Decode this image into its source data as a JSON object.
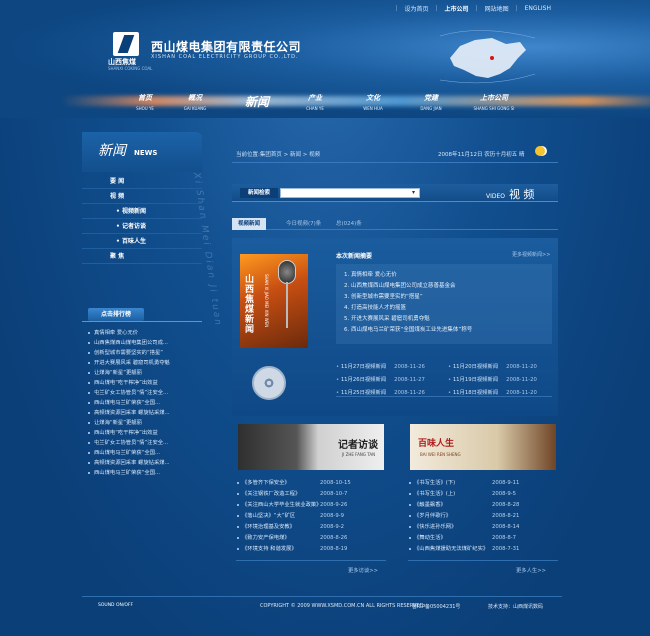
{
  "topnav": {
    "items": [
      {
        "label": "设为首页"
      },
      {
        "label": "上市公司"
      },
      {
        "label": "网站地图"
      },
      {
        "label": "ENGLISH"
      }
    ]
  },
  "logo": {
    "sub_cn": "山西焦煤",
    "sub_en": "SHANXI COKING COAL"
  },
  "company": {
    "name_cn": "西山煤电集团有限责任公司",
    "name_en": "XISHAN COAL ELECTRICITY GROUP CO.,LTD."
  },
  "mainnav": {
    "items": [
      {
        "cn": "首页",
        "en": "SHOU YE"
      },
      {
        "cn": "概况",
        "en": "GAI KUANG"
      },
      {
        "cn": "新闻",
        "en": ""
      },
      {
        "cn": "产业",
        "en": "CHAN YE"
      },
      {
        "cn": "文化",
        "en": "WEN HUA"
      },
      {
        "cn": "党建",
        "en": "DANG JIAN"
      },
      {
        "cn": "上市公司",
        "en": "SHANG SHI GONG SI"
      }
    ]
  },
  "left": {
    "title_cn": "新闻",
    "title_en": "NEWS",
    "menu": [
      {
        "label": "要 闻",
        "sub": false
      },
      {
        "label": "视 频",
        "sub": false
      },
      {
        "label": "视频新闻",
        "sub": true
      },
      {
        "label": "记者访谈",
        "sub": true
      },
      {
        "label": "百味人生",
        "sub": true
      },
      {
        "label": "聚 焦",
        "sub": false
      }
    ],
    "rank_title": "点击排行榜",
    "rank_list": [
      "真情相牵 爱心无价",
      "山西焦煤西山煤电集团公司成...",
      "创新型城市需要坚实的“搭星”",
      "开进大赛展风采 碧窟司机勇夺魁",
      "让煤海“新星”更靓丽",
      "西山煤电“吃干榨净”出效益",
      "屯兰矿女工协管员“情”注安全...",
      "西山煤电马兰矿荣获“全国...",
      "高频煤资源回采率 螺旋钻采煤...",
      "让煤海“新星”更靓丽",
      "西山煤电“吃干榨净”出效益",
      "屯兰矿女工协管员“情”注安全...",
      "西山煤电马兰矿荣获“全国...",
      "高频煤资源回采率 螺旋钻采煤...",
      "西山煤电马兰矿荣获“全国..."
    ]
  },
  "watermark": "Xi Shan Mei Dian Ji tuan",
  "crumb": {
    "text": "当前位置:集团首页 > 新闻 > 视频",
    "date": "2008年11月12日 农历十月初五 晴"
  },
  "search": {
    "label": "新闻检索",
    "value": "",
    "placeholder": ""
  },
  "video_title": {
    "en": "VIDEO",
    "cn": "视 频"
  },
  "tabs": [
    {
      "label": "视频新闻",
      "active": true
    },
    {
      "label": "今日视频(7)条",
      "active": false
    },
    {
      "label": "总(024)条",
      "active": false
    }
  ],
  "feature": {
    "image_label": "山西焦煤新闻",
    "image_label_en": "SHAN XI JIAO MEI XIN WEN",
    "digest_title": "本次新闻摘要",
    "digest_more": "更多视频新闻>>",
    "digest": [
      "1. 真情相牵 爱心无价",
      "2. 山西焦煤西山煤电集团公司成立慈善基金会",
      "3. 创新型城市需要坚实的“搭星”",
      "4. 打造高技能人才的摇篮",
      "5. 开进大赛展风采 碧窟司机勇夺魁",
      "6. 西山煤电马兰矿荣获“全国煤炭工业先进集体”称号"
    ],
    "videos": [
      {
        "title": "11月27日视频新闻",
        "date": "2008-11-26"
      },
      {
        "title": "11月20日视频新闻",
        "date": "2008-11-20"
      },
      {
        "title": "11月26日视频新闻",
        "date": "2008-11-27"
      },
      {
        "title": "11月19日视频新闻",
        "date": "2008-11-20"
      },
      {
        "title": "11月25日视频新闻",
        "date": "2008-11-26"
      },
      {
        "title": "11月18日视频新闻",
        "date": "2008-11-20"
      }
    ]
  },
  "panel_interview": {
    "image_title": "记者访谈",
    "image_en": "JI ZHE FANG TAN",
    "items": [
      {
        "title": "《多管齐下保安全》",
        "date": "2008-10-15"
      },
      {
        "title": "《关注钢铁厂改造工程》",
        "date": "2008-10-7"
      },
      {
        "title": "《关注西山大学毕业生就业政策》",
        "date": "2008-9-26"
      },
      {
        "title": "《落山坚决》“大”矿区",
        "date": "2008-9-9"
      },
      {
        "title": "《环境治理基及安教》",
        "date": "2008-9-2"
      },
      {
        "title": "《致力安产保电煤》",
        "date": "2008-8-26"
      },
      {
        "title": "《环境支持 和谐发展》",
        "date": "2008-8-19"
      }
    ],
    "more": "更多访谈>>"
  },
  "panel_life": {
    "image_title": "百味人生",
    "image_en": "BAI WEI REN SHENG",
    "items": [
      {
        "title": "《书写生活》(下)",
        "date": "2008-9-11"
      },
      {
        "title": "《书写生活》(上)",
        "date": "2008-9-5"
      },
      {
        "title": "《触墨飘香》",
        "date": "2008-8-28"
      },
      {
        "title": "《岁月伴歌行》",
        "date": "2008-8-21"
      },
      {
        "title": "《快乐进孙乐网》",
        "date": "2008-8-14"
      },
      {
        "title": "《舞动生活》",
        "date": "2008-8-7"
      },
      {
        "title": "《山西焦煤援助无法煤矿纪实》",
        "date": "2008-7-31"
      }
    ],
    "more": "更多人生>>"
  },
  "footer": {
    "sound": "SOUND ON/OFF",
    "copyright": "COPYRIGHT © 2009 WWW.XSMD.COM.CN ALL RIGHTS RESERVED.",
    "icp": "晋ICP备05004231号",
    "support": "技术支持：山西煤讯数码"
  }
}
